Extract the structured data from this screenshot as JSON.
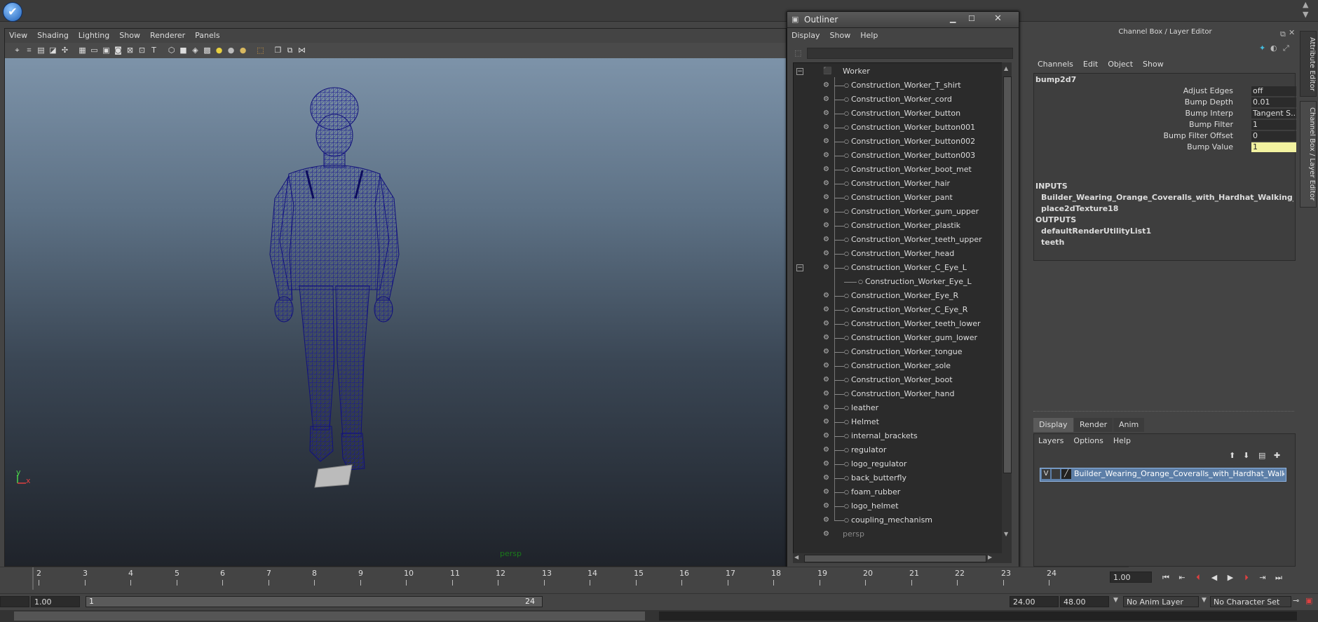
{
  "viewport": {
    "menus": [
      "View",
      "Shading",
      "Lighting",
      "Show",
      "Renderer",
      "Panels"
    ],
    "camera_label": "persp",
    "axis_y": "y",
    "axis_x": "x"
  },
  "outliner": {
    "title": "Outliner",
    "menus": [
      "Display",
      "Show",
      "Help"
    ],
    "root": "Worker",
    "items": [
      "Construction_Worker_T_shirt",
      "Construction_Worker_cord",
      "Construction_Worker_button",
      "Construction_Worker_button001",
      "Construction_Worker_button002",
      "Construction_Worker_button003",
      "Construction_Worker_boot_met",
      "Construction_Worker_hair",
      "Construction_Worker_pant",
      "Construction_Worker_gum_upper",
      "Construction_Worker_plastik",
      "Construction_Worker_teeth_upper",
      "Construction_Worker_head",
      "Construction_Worker_C_Eye_L",
      "Construction_Worker_Eye_L",
      "Construction_Worker_Eye_R",
      "Construction_Worker_C_Eye_R",
      "Construction_Worker_teeth_lower",
      "Construction_Worker_gum_lower",
      "Construction_Worker_tongue",
      "Construction_Worker_sole",
      "Construction_Worker_boot",
      "Construction_Worker_hand",
      "leather",
      "Helmet",
      "internal_brackets",
      "regulator",
      "logo_regulator",
      "back_butterfly",
      "foam_rubber",
      "logo_helmet",
      "coupling_mechanism"
    ],
    "trailing_item": "persp"
  },
  "channel_box": {
    "title": "Channel Box / Layer Editor",
    "menus": [
      "Channels",
      "Edit",
      "Object",
      "Show"
    ],
    "node": "bump2d7",
    "attributes": [
      {
        "label": "Adjust Edges",
        "value": "off"
      },
      {
        "label": "Bump Depth",
        "value": "0.01"
      },
      {
        "label": "Bump Interp",
        "value": "Tangent S..."
      },
      {
        "label": "Bump Filter",
        "value": "1"
      },
      {
        "label": "Bump Filter Offset",
        "value": "0"
      },
      {
        "label": "Bump Value",
        "value": "1"
      }
    ],
    "inputs_label": "INPUTS",
    "inputs": [
      "Builder_Wearing_Orange_Coveralls_with_Hardhat_Walking_...",
      "place2dTexture18"
    ],
    "outputs_label": "OUTPUTS",
    "outputs": [
      "defaultRenderUtilityList1",
      "teeth"
    ],
    "side_tabs": [
      "Attribute Editor",
      "Channel Box / Layer Editor"
    ]
  },
  "layer_editor": {
    "tabs": [
      "Display",
      "Render",
      "Anim"
    ],
    "menus": [
      "Layers",
      "Options",
      "Help"
    ],
    "layer_visible": "V",
    "layer_name": "Builder_Wearing_Orange_Coveralls_with_Hardhat_Walking_Po:"
  },
  "timeline": {
    "ticks": [
      "2",
      "3",
      "4",
      "5",
      "6",
      "7",
      "8",
      "9",
      "10",
      "11",
      "12",
      "13",
      "14",
      "15",
      "16",
      "17",
      "18",
      "19",
      "20",
      "21",
      "22",
      "23",
      "24"
    ],
    "current_frame": "1.00"
  },
  "range": {
    "start": "1.00",
    "slider_start": "1",
    "slider_end": "24",
    "end": "24.00",
    "anim_end": "48.00",
    "anim_layer": "No Anim Layer",
    "character_set": "No Character Set"
  },
  "colors": {
    "wireframe": "#1a1a8c",
    "selected_layer": "#5d7fa8",
    "highlight_field": "#f2f2a0",
    "camera_label": "#1a7a1a"
  }
}
